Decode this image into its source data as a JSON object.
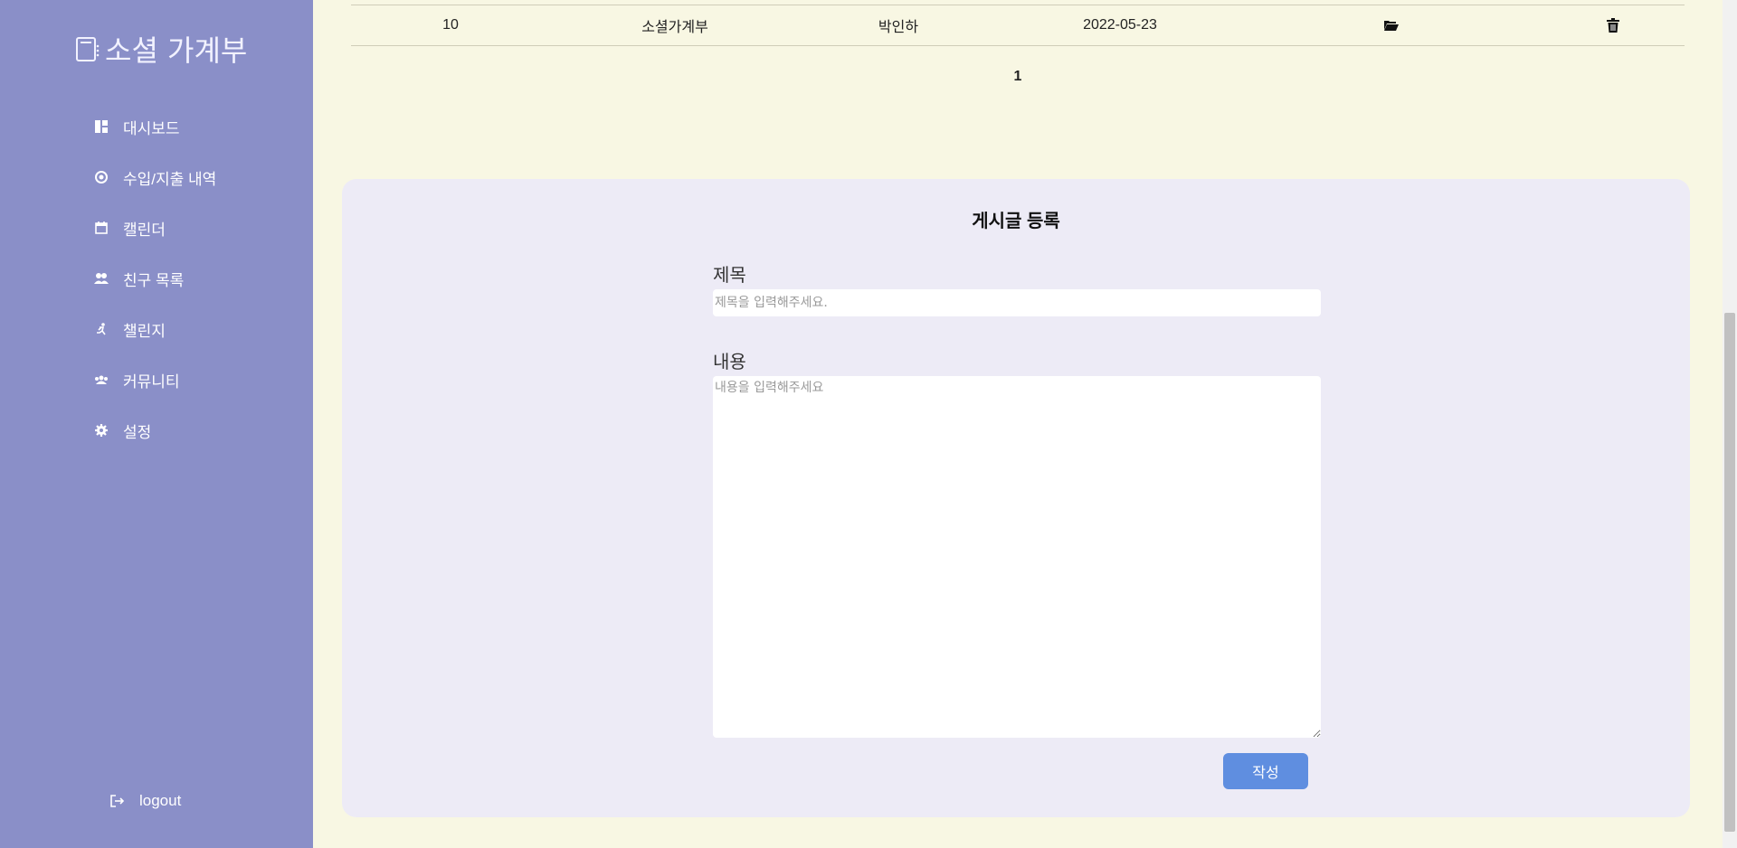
{
  "brand": {
    "title": "소셜 가계부"
  },
  "sidebar": {
    "items": [
      {
        "label": "대시보드",
        "icon": "dashboard-icon"
      },
      {
        "label": "수입/지출 내역",
        "icon": "coin-icon"
      },
      {
        "label": "캘린더",
        "icon": "calendar-icon"
      },
      {
        "label": "친구 목록",
        "icon": "friends-icon"
      },
      {
        "label": "챌린지",
        "icon": "running-icon"
      },
      {
        "label": "커뮤니티",
        "icon": "community-icon"
      },
      {
        "label": "설정",
        "icon": "gear-icon"
      }
    ],
    "logout": "logout"
  },
  "table": {
    "row": {
      "no": "10",
      "title": "소셜가계부",
      "author": "박인하",
      "date": "2022-05-23",
      "open_icon": "folder-open-icon",
      "delete_icon": "trash-icon"
    }
  },
  "pagination": {
    "current": "1"
  },
  "form": {
    "heading": "게시글 등록",
    "title_label": "제목",
    "title_placeholder": "제목을 입력해주세요.",
    "content_label": "내용",
    "content_placeholder": "내용을 입력해주세요",
    "submit_label": "작성"
  },
  "colors": {
    "sidebar": "#8a8fc8",
    "background": "#f8f7e3",
    "card": "#edebf6",
    "button": "#5f8ee0"
  }
}
